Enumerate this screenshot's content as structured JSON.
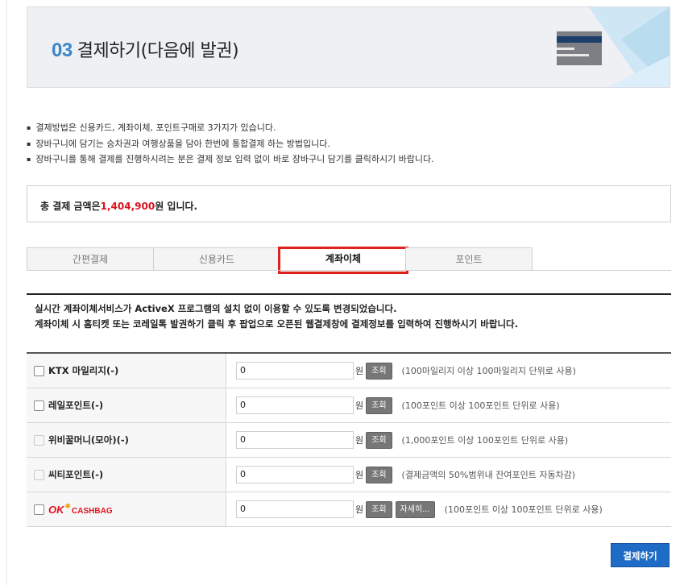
{
  "header": {
    "step_number": "03",
    "title": "결제하기(다음에 발권)"
  },
  "notices": [
    "결제방법은 신용카드, 계좌이체, 포인트구매로 3가지가 있습니다.",
    "장바구니에 담기는 승차권과 여행상품을 담아 한번에 통합결제 하는 방법입니다.",
    "장바구니를 통해 결제를 진행하시려는 분은 결제 정보 입력 없이 바로 장바구니 담기를 클릭하시기 바랍니다."
  ],
  "total": {
    "prefix": "총 결제 금액은",
    "amount": "1,404,900",
    "suffix": "원 입니다."
  },
  "tabs": [
    {
      "label": "간편결제",
      "active": false
    },
    {
      "label": "신용카드",
      "active": false
    },
    {
      "label": "계좌이체",
      "active": true
    },
    {
      "label": "포인트",
      "active": false
    }
  ],
  "info": {
    "line1": "실시간 계좌이체서비스가 ActiveX 프로그램의 설치 없이 이용할 수 있도록 변경되었습니다.",
    "line2": "계좌이체 시 홈티켓 또는 코레일톡 발권하기 클릭 후 팝업으로 오픈된 웹결제창에 결제정보를 입력하여 진행하시기 바랍니다."
  },
  "points": [
    {
      "label": "KTX 마일리지(-)",
      "value": "0",
      "unit": "원",
      "query": "조회",
      "hint": "(100마일리지 이상 100마일리지 단위로 사용)",
      "enabled": true
    },
    {
      "label": "레일포인트(-)",
      "value": "0",
      "unit": "원",
      "query": "조회",
      "hint": "(100포인트 이상 100포인트 단위로 사용)",
      "enabled": true
    },
    {
      "label": "위비꿀머니(모아)(-)",
      "value": "0",
      "unit": "원",
      "query": "조회",
      "hint": "(1,000포인트 이상 100포인트 단위로 사용)",
      "enabled": false
    },
    {
      "label": "씨티포인트(-)",
      "value": "0",
      "unit": "원",
      "query": "조회",
      "hint": "(결제금액의 50%범위내 잔여포인트 자동차감)",
      "enabled": false
    },
    {
      "label_ok": "OK",
      "label_cashbag": "CASHBAG",
      "value": "0",
      "unit": "원",
      "query": "조회",
      "detail": "자세히...",
      "hint": "(100포인트 이상 100포인트 단위로 사용)",
      "enabled": true
    }
  ],
  "pay_button": "결제하기",
  "colors": {
    "accent_blue": "#1f6cc7",
    "amount_red": "#d8141f",
    "tab_highlight": "#e0221e",
    "banner_bg": "#eef0f3"
  }
}
